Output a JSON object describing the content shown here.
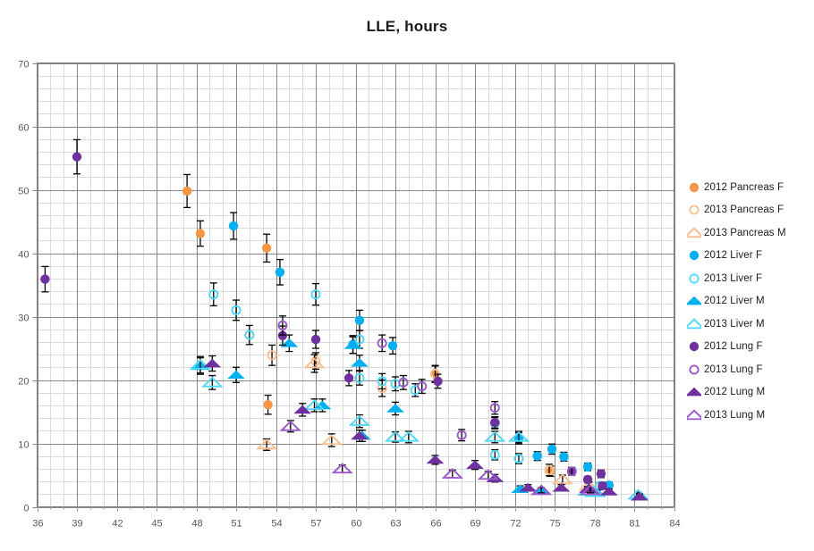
{
  "chart_data": {
    "type": "scatter",
    "title": "LLE, hours",
    "xlabel": "",
    "ylabel": "",
    "xlim": [
      36,
      84
    ],
    "ylim": [
      0,
      70
    ],
    "x_major_step": 3,
    "x_minor_step": 1,
    "y_major_step": 10,
    "y_minor_step": 2,
    "grid": true,
    "legend_position": "right",
    "x_ticks": [
      "36",
      "39",
      "42",
      "45",
      "48",
      "51",
      "54",
      "57",
      "60",
      "63",
      "66",
      "69",
      "72",
      "75",
      "78",
      "81",
      "84"
    ],
    "y_ticks": [
      "0",
      "10",
      "20",
      "30",
      "40",
      "50",
      "60",
      "70"
    ],
    "error_bars": true,
    "colors": {
      "pancreas": "#F79646",
      "liver": "#00B0F0",
      "lung": "#7030A0"
    },
    "series": [
      {
        "name": "2012 Pancreas F",
        "color": "#F79646",
        "marker": "circle-filled",
        "points": [
          {
            "x": 47.3,
            "y": 49.8,
            "err": 2.6
          },
          {
            "x": 48.3,
            "y": 43.1,
            "err": 2.0
          },
          {
            "x": 53.3,
            "y": 40.8,
            "err": 2.2
          },
          {
            "x": 53.4,
            "y": 16.1,
            "err": 1.5
          },
          {
            "x": 66.0,
            "y": 20.9,
            "err": 1.3
          },
          {
            "x": 74.7,
            "y": 5.6,
            "err": 0.8
          }
        ]
      },
      {
        "name": "2013 Pancreas F",
        "color": "#F9BE8F",
        "marker": "circle-open",
        "points": [
          {
            "x": 53.7,
            "y": 23.9,
            "err": 1.6
          },
          {
            "x": 57.0,
            "y": 23.0,
            "err": 1.3
          },
          {
            "x": 62.0,
            "y": 18.7,
            "err": 1.3
          },
          {
            "x": 66.0,
            "y": 21.0,
            "err": 1.3
          },
          {
            "x": 74.6,
            "y": 5.8,
            "err": 0.9
          }
        ]
      },
      {
        "name": "2013 Pancreas M",
        "color": "#F9BE8F",
        "marker": "triangle-open",
        "points": [
          {
            "x": 56.9,
            "y": 22.6,
            "err": 1.4
          },
          {
            "x": 53.3,
            "y": 9.8,
            "err": 0.9
          },
          {
            "x": 58.2,
            "y": 10.5,
            "err": 1.0
          },
          {
            "x": 75.6,
            "y": 4.3,
            "err": 0.7
          },
          {
            "x": 77.6,
            "y": 3.3,
            "err": 0.6
          }
        ]
      },
      {
        "name": "2012 Liver F",
        "color": "#00B0F0",
        "marker": "circle-filled",
        "points": [
          {
            "x": 50.8,
            "y": 44.3,
            "err": 2.1
          },
          {
            "x": 54.3,
            "y": 37.0,
            "err": 2.0
          },
          {
            "x": 60.3,
            "y": 29.4,
            "err": 1.6
          },
          {
            "x": 59.8,
            "y": 25.6,
            "err": 1.4
          },
          {
            "x": 62.8,
            "y": 25.4,
            "err": 1.3
          },
          {
            "x": 70.5,
            "y": 13.3,
            "err": 0.9
          },
          {
            "x": 72.3,
            "y": 10.8,
            "err": 0.9
          },
          {
            "x": 73.7,
            "y": 8.0,
            "err": 0.7
          },
          {
            "x": 74.8,
            "y": 9.1,
            "err": 0.8
          },
          {
            "x": 75.7,
            "y": 7.9,
            "err": 0.7
          },
          {
            "x": 77.5,
            "y": 6.3,
            "err": 0.6
          },
          {
            "x": 79.1,
            "y": 3.4,
            "err": 0.5
          }
        ]
      },
      {
        "name": "2013 Liver F",
        "color": "#4FD8F5",
        "marker": "circle-open",
        "points": [
          {
            "x": 49.3,
            "y": 33.5,
            "err": 1.8
          },
          {
            "x": 51.0,
            "y": 31.0,
            "err": 1.6
          },
          {
            "x": 52.0,
            "y": 27.1,
            "err": 1.5
          },
          {
            "x": 57.0,
            "y": 33.5,
            "err": 1.7
          },
          {
            "x": 60.3,
            "y": 26.4,
            "err": 1.4
          },
          {
            "x": 60.3,
            "y": 20.3,
            "err": 1.1
          },
          {
            "x": 62.0,
            "y": 19.8,
            "err": 1.2
          },
          {
            "x": 63.0,
            "y": 19.4,
            "err": 1.1
          },
          {
            "x": 64.5,
            "y": 18.4,
            "err": 1.0
          },
          {
            "x": 70.5,
            "y": 13.2,
            "err": 0.9
          },
          {
            "x": 70.5,
            "y": 8.2,
            "err": 0.8
          },
          {
            "x": 72.3,
            "y": 7.6,
            "err": 0.8
          },
          {
            "x": 78.4,
            "y": 3.3,
            "err": 0.5
          }
        ]
      },
      {
        "name": "2012 Liver M",
        "color": "#00B0F0",
        "marker": "triangle-filled",
        "points": [
          {
            "x": 48.3,
            "y": 22.2,
            "err": 1.3
          },
          {
            "x": 51.0,
            "y": 20.8,
            "err": 1.2
          },
          {
            "x": 55.0,
            "y": 25.8,
            "err": 1.3
          },
          {
            "x": 59.8,
            "y": 25.5,
            "err": 1.3
          },
          {
            "x": 57.5,
            "y": 16.0,
            "err": 1.0
          },
          {
            "x": 60.3,
            "y": 22.7,
            "err": 1.2
          },
          {
            "x": 60.5,
            "y": 11.2,
            "err": 0.9
          },
          {
            "x": 63.0,
            "y": 15.5,
            "err": 1.0
          },
          {
            "x": 72.4,
            "y": 2.8,
            "err": 0.5
          },
          {
            "x": 74.0,
            "y": 2.6,
            "err": 0.4
          },
          {
            "x": 78.2,
            "y": 2.2,
            "err": 0.4
          },
          {
            "x": 81.4,
            "y": 1.7,
            "err": 0.4
          }
        ]
      },
      {
        "name": "2013 Liver M",
        "color": "#4FD8F5",
        "marker": "triangle-open",
        "points": [
          {
            "x": 48.3,
            "y": 22.4,
            "err": 1.3
          },
          {
            "x": 49.2,
            "y": 19.6,
            "err": 1.1
          },
          {
            "x": 56.9,
            "y": 16.0,
            "err": 1.0
          },
          {
            "x": 60.3,
            "y": 13.5,
            "err": 1.0
          },
          {
            "x": 64.0,
            "y": 11.0,
            "err": 0.9
          },
          {
            "x": 63.0,
            "y": 11.0,
            "err": 0.8
          },
          {
            "x": 70.5,
            "y": 11.0,
            "err": 0.9
          },
          {
            "x": 72.3,
            "y": 11.0,
            "err": 0.9
          },
          {
            "x": 77.5,
            "y": 2.5,
            "err": 0.5
          },
          {
            "x": 78.0,
            "y": 2.3,
            "err": 0.4
          },
          {
            "x": 81.3,
            "y": 1.9,
            "err": 0.4
          }
        ]
      },
      {
        "name": "2012 Lung F",
        "color": "#7030A0",
        "marker": "circle-filled",
        "points": [
          {
            "x": 36.6,
            "y": 35.9,
            "err": 2.0
          },
          {
            "x": 39.0,
            "y": 55.2,
            "err": 2.7
          },
          {
            "x": 54.5,
            "y": 27.0,
            "err": 1.5
          },
          {
            "x": 57.0,
            "y": 26.4,
            "err": 1.4
          },
          {
            "x": 59.5,
            "y": 20.3,
            "err": 1.2
          },
          {
            "x": 66.2,
            "y": 19.8,
            "err": 1.1
          },
          {
            "x": 70.5,
            "y": 13.3,
            "err": 0.9
          },
          {
            "x": 76.3,
            "y": 5.6,
            "err": 0.6
          },
          {
            "x": 77.5,
            "y": 4.3,
            "err": 0.5
          },
          {
            "x": 78.5,
            "y": 5.2,
            "err": 0.6
          },
          {
            "x": 78.6,
            "y": 3.3,
            "err": 0.5
          }
        ]
      },
      {
        "name": "2013 Lung F",
        "color": "#9B59C9",
        "marker": "circle-open",
        "points": [
          {
            "x": 54.5,
            "y": 28.6,
            "err": 1.5
          },
          {
            "x": 62.0,
            "y": 25.8,
            "err": 1.3
          },
          {
            "x": 63.6,
            "y": 19.6,
            "err": 1.1
          },
          {
            "x": 65.0,
            "y": 19.0,
            "err": 1.1
          },
          {
            "x": 68.0,
            "y": 11.3,
            "err": 0.9
          },
          {
            "x": 70.5,
            "y": 15.6,
            "err": 1.0
          },
          {
            "x": 76.3,
            "y": 5.6,
            "err": 0.6
          }
        ]
      },
      {
        "name": "2012 Lung M",
        "color": "#7030A0",
        "marker": "triangle-filled",
        "points": [
          {
            "x": 49.2,
            "y": 22.6,
            "err": 1.2
          },
          {
            "x": 56.0,
            "y": 15.3,
            "err": 1.0
          },
          {
            "x": 60.3,
            "y": 11.2,
            "err": 0.9
          },
          {
            "x": 66.0,
            "y": 7.4,
            "err": 0.7
          },
          {
            "x": 69.0,
            "y": 6.6,
            "err": 0.7
          },
          {
            "x": 70.5,
            "y": 4.5,
            "err": 0.6
          },
          {
            "x": 73.0,
            "y": 3.0,
            "err": 0.5
          },
          {
            "x": 75.5,
            "y": 3.0,
            "err": 0.5
          },
          {
            "x": 77.5,
            "y": 2.8,
            "err": 0.4
          },
          {
            "x": 79.1,
            "y": 2.4,
            "err": 0.4
          },
          {
            "x": 81.4,
            "y": 1.6,
            "err": 0.4
          }
        ]
      },
      {
        "name": "2013 Lung M",
        "color": "#9B59C9",
        "marker": "triangle-open",
        "points": [
          {
            "x": 55.1,
            "y": 12.7,
            "err": 0.9
          },
          {
            "x": 59.0,
            "y": 6.0,
            "err": 0.6
          },
          {
            "x": 67.3,
            "y": 5.2,
            "err": 0.6
          },
          {
            "x": 70.0,
            "y": 5.0,
            "err": 0.6
          },
          {
            "x": 74.0,
            "y": 2.6,
            "err": 0.4
          },
          {
            "x": 77.7,
            "y": 2.6,
            "err": 0.4
          }
        ]
      }
    ]
  },
  "legend": {
    "items": [
      {
        "label": "2012 Pancreas F",
        "marker": "circle-filled",
        "color": "#F79646"
      },
      {
        "label": "2013 Pancreas F",
        "marker": "circle-open",
        "color": "#F9BE8F"
      },
      {
        "label": "2013 Pancreas M",
        "marker": "triangle-open",
        "color": "#F9BE8F"
      },
      {
        "label": "2012 Liver  F",
        "marker": "circle-filled",
        "color": "#00B0F0"
      },
      {
        "label": "2013 Liver  F",
        "marker": "circle-open",
        "color": "#4FD8F5"
      },
      {
        "label": "2012 Liver  M",
        "marker": "triangle-filled",
        "color": "#00B0F0"
      },
      {
        "label": "2013 Liver  M",
        "marker": "triangle-open",
        "color": "#4FD8F5"
      },
      {
        "label": "2012 Lung F",
        "marker": "circle-filled",
        "color": "#7030A0"
      },
      {
        "label": "2013 Lung F",
        "marker": "circle-open",
        "color": "#9B59C9"
      },
      {
        "label": "2012 Lung M",
        "marker": "triangle-filled",
        "color": "#7030A0"
      },
      {
        "label": "2013 Lung M",
        "marker": "triangle-open",
        "color": "#9B59C9"
      }
    ]
  }
}
